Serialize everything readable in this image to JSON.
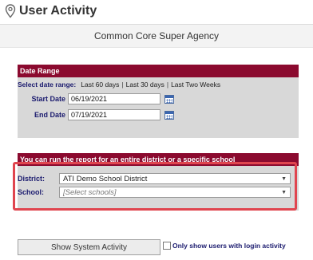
{
  "header": {
    "title": "User Activity",
    "pin_icon": "location-pin-icon"
  },
  "agency": "Common Core Super Agency",
  "date_range": {
    "heading": "Date Range",
    "select_label": "Select date range:",
    "options": [
      "Last 60 days",
      "Last 30 days",
      "Last Two Weeks"
    ],
    "start_label": "Start Date",
    "start_value": "06/19/2021",
    "end_label": "End Date",
    "end_value": "07/19/2021"
  },
  "scope": {
    "heading": "You can run the report for an entire district or a specific school",
    "district_label": "District:",
    "district_value": "ATI Demo School District",
    "school_label": "School:",
    "school_placeholder": "[Select schools]"
  },
  "actions": {
    "show_button": "Show System Activity",
    "login_only_label": "Only show users with login activity"
  },
  "colors": {
    "panel_header": "#8b0a2f",
    "panel_bg": "#d8d8d8",
    "label_text": "#1a1a6e",
    "highlight": "#e0454f"
  }
}
